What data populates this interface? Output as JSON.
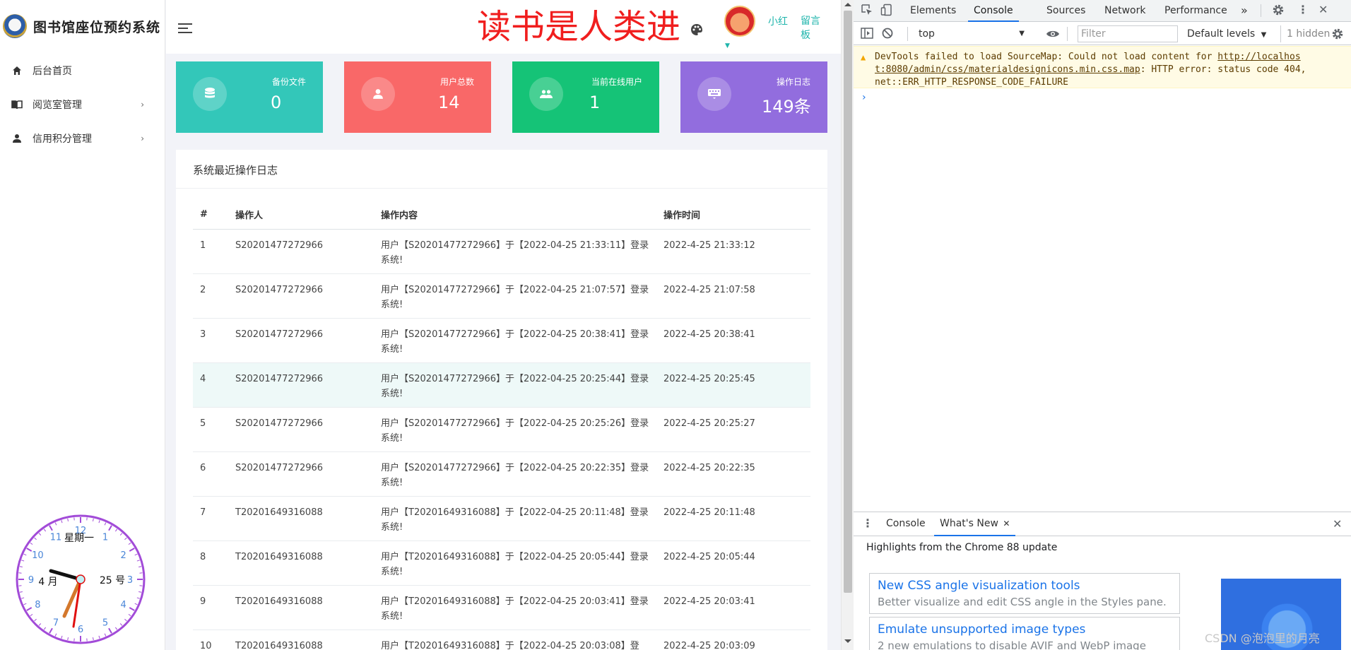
{
  "app": {
    "brand_title": "图书馆座位预约系统",
    "sidebar": [
      {
        "label": "后台首页",
        "icon": "home-icon",
        "has_children": false
      },
      {
        "label": "阅览室管理",
        "icon": "book-icon",
        "has_children": true
      },
      {
        "label": "信用积分管理",
        "icon": "user-icon",
        "has_children": true
      }
    ],
    "clock": {
      "weekday": "星期一",
      "month": "4 月",
      "day": "25 号",
      "numbers": [
        "12",
        "1",
        "2",
        "3",
        "4",
        "5",
        "6",
        "7",
        "8",
        "9",
        "10",
        "11"
      ]
    },
    "header": {
      "marquee_text": "读书是人类进",
      "user_name": "小红",
      "message_board": "留言板"
    },
    "stats": [
      {
        "label": "备份文件",
        "value": "0",
        "color": "#33c7b9",
        "icon": "database-icon"
      },
      {
        "label": "用户总数",
        "value": "14",
        "color": "#f96868",
        "icon": "user-icon"
      },
      {
        "label": "当前在线用户",
        "value": "1",
        "color": "#15c377",
        "icon": "users-icon"
      },
      {
        "label": "操作日志",
        "value": "149条",
        "color": "#926dde",
        "icon": "keyboard-icon"
      }
    ],
    "log_panel": {
      "title": "系统最近操作日志",
      "columns": [
        "#",
        "操作人",
        "操作内容",
        "操作时间"
      ],
      "rows": [
        {
          "n": "1",
          "op": "S20201477272966",
          "content": "用户【S20201477272966】于【2022-04-25 21:33:11】登录系统!",
          "time": "2022-4-25 21:33:12"
        },
        {
          "n": "2",
          "op": "S20201477272966",
          "content": "用户【S20201477272966】于【2022-04-25 21:07:57】登录系统!",
          "time": "2022-4-25 21:07:58"
        },
        {
          "n": "3",
          "op": "S20201477272966",
          "content": "用户【S20201477272966】于【2022-04-25 20:38:41】登录系统!",
          "time": "2022-4-25 20:38:41"
        },
        {
          "n": "4",
          "op": "S20201477272966",
          "content": "用户【S20201477272966】于【2022-04-25 20:25:44】登录系统!",
          "time": "2022-4-25 20:25:45"
        },
        {
          "n": "5",
          "op": "S20201477272966",
          "content": "用户【S20201477272966】于【2022-04-25 20:25:26】登录系统!",
          "time": "2022-4-25 20:25:27"
        },
        {
          "n": "6",
          "op": "S20201477272966",
          "content": "用户【S20201477272966】于【2022-04-25 20:22:35】登录系统!",
          "time": "2022-4-25 20:22:35"
        },
        {
          "n": "7",
          "op": "T20201649316088",
          "content": "用户【T20201649316088】于【2022-04-25 20:11:48】登录系统!",
          "time": "2022-4-25 20:11:48"
        },
        {
          "n": "8",
          "op": "T20201649316088",
          "content": "用户【T20201649316088】于【2022-04-25 20:05:44】登录系统!",
          "time": "2022-4-25 20:05:44"
        },
        {
          "n": "9",
          "op": "T20201649316088",
          "content": "用户【T20201649316088】于【2022-04-25 20:03:41】登录系统!",
          "time": "2022-4-25 20:03:41"
        },
        {
          "n": "10",
          "op": "T20201649316088",
          "content": "用户【T20201649316088】于【2022-04-25 20:03:08】登",
          "time": "2022-4-25 20:03:09"
        }
      ]
    }
  },
  "devtools": {
    "tabs": [
      "Elements",
      "Console",
      "Sources",
      "Network",
      "Performance"
    ],
    "active_tab": "Console",
    "more_tabs": "»",
    "context": "top",
    "filter_placeholder": "Filter",
    "levels": "Default levels",
    "hidden": "1 hidden",
    "warning": {
      "prefix": "DevTools failed to load SourceMap: Could not load content for ",
      "link": "http://localhos",
      "link2": "t:8080/admin/css/materialdesignicons.min.css.map",
      "suffix": ": HTTP error: status code 404,",
      "line3": "net::ERR_HTTP_RESPONSE_CODE_FAILURE"
    },
    "prompt": "›",
    "drawer": {
      "tabs": [
        "Console",
        "What's New"
      ],
      "active_tab": "What's New",
      "highlights": "Highlights from the Chrome 88 update",
      "features": [
        {
          "title": "New CSS angle visualization tools",
          "desc": "Better visualize and edit CSS angle in the Styles pane."
        },
        {
          "title": "Emulate unsupported image types",
          "desc": "2 new emulations to disable AVIF and WebP image"
        }
      ]
    }
  },
  "watermark": "CSDN @泡泡里的月亮"
}
